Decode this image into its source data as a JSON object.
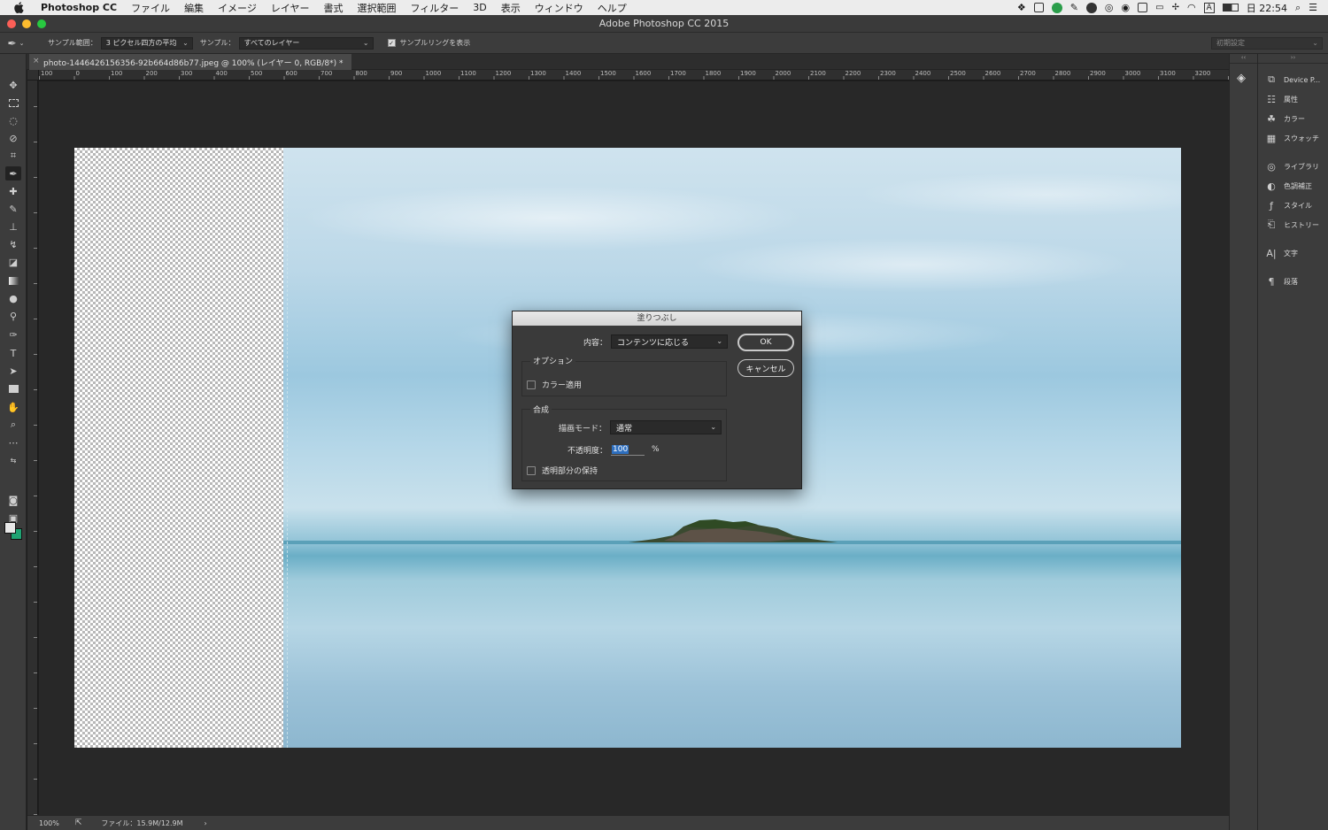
{
  "menubar": {
    "items": [
      "Photoshop CC",
      "ファイル",
      "編集",
      "イメージ",
      "レイヤー",
      "書式",
      "選択範囲",
      "フィルター",
      "3D",
      "表示",
      "ウィンドウ",
      "ヘルプ"
    ],
    "clock": "日 22:54"
  },
  "window": {
    "title": "Adobe Photoshop CC 2015"
  },
  "options": {
    "sample_size_label": "サンプル範囲：",
    "sample_size_value": "3 ピクセル四方の平均",
    "sample_label": "サンプル：",
    "sample_value": "すべてのレイヤー",
    "show_ring_label": "サンプルリングを表示",
    "preset": "初期設定"
  },
  "document": {
    "tab_title": "photo-1446426156356-92b664d86b77.jpeg @ 100% (レイヤー 0, RGB/8*) *"
  },
  "ruler": {
    "marks": [
      "100",
      "0",
      "100",
      "200",
      "300",
      "400",
      "500",
      "600",
      "700",
      "800",
      "900",
      "1000",
      "1100",
      "1200",
      "1300",
      "1400",
      "1500",
      "1600",
      "1700",
      "1800",
      "1900",
      "2000",
      "2100",
      "2200",
      "2300",
      "2400",
      "2500",
      "2600",
      "2700",
      "2800",
      "2900",
      "3000",
      "3100",
      "3200"
    ]
  },
  "status": {
    "zoom": "100%",
    "file": "ファイル：15.9M/12.9M",
    "arrow": "›"
  },
  "panels": {
    "items": [
      "Device P...",
      "属性",
      "カラー",
      "スウォッチ",
      "ライブラリ",
      "色調補正",
      "スタイル",
      "ヒストリー",
      "文字",
      "段落"
    ]
  },
  "dialog": {
    "title": "塗りつぶし",
    "contents_label": "内容：",
    "contents_value": "コンテンツに応じる",
    "ok": "OK",
    "cancel": "キャンセル",
    "options_group": "オプション",
    "color_adapt": "カラー適用",
    "blend_group": "合成",
    "mode_label": "描画モード：",
    "mode_value": "通常",
    "opacity_label": "不透明度：",
    "opacity_value": "100",
    "opacity_unit": "%",
    "preserve_transparency": "透明部分の保持"
  },
  "colors": {
    "foreground": "#e8e8e8",
    "background": "#1fa373",
    "ui_dark": "#3c3c3c"
  }
}
